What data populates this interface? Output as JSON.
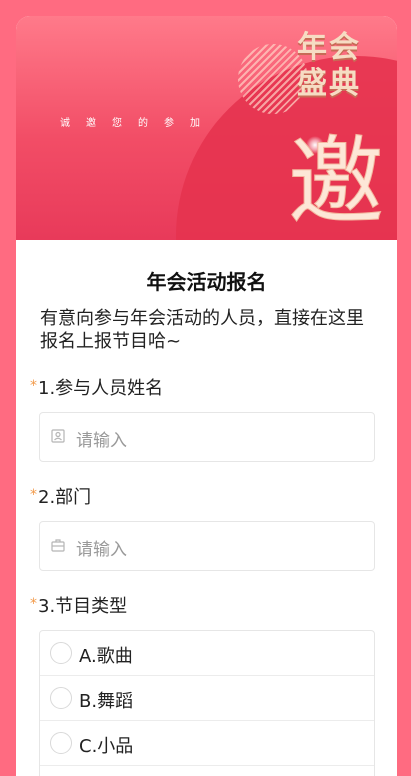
{
  "banner": {
    "title_line1": "年会",
    "title_line2": "盛典",
    "invite_text": "诚邀您的参加",
    "big_char": "邀"
  },
  "form": {
    "title": "年会活动报名",
    "description": "有意向参与年会活动的人员，直接在这里报名上报节目哈~"
  },
  "questions": [
    {
      "required_mark": "*",
      "label": "1.参与人员姓名",
      "placeholder": "请输入",
      "icon": "user-icon"
    },
    {
      "required_mark": "*",
      "label": "2.部门",
      "placeholder": "请输入",
      "icon": "briefcase-icon"
    },
    {
      "required_mark": "*",
      "label": "3.节目类型",
      "options": [
        "A.歌曲",
        "B.舞蹈",
        "C.小品"
      ]
    }
  ],
  "colors": {
    "background": "#ff6b81",
    "banner": "#f24d66",
    "required": "#f29a4a",
    "placeholder": "#999999"
  }
}
